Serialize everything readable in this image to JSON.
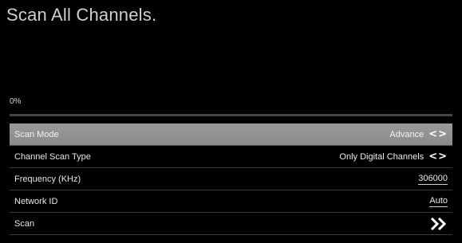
{
  "title": "Scan All Channels.",
  "progress": {
    "text": "0%",
    "value": 0
  },
  "menu": {
    "rows": [
      {
        "label": "Scan Mode",
        "value": "Advance",
        "arrows": "<>"
      },
      {
        "label": "Channel Scan Type",
        "value": "Only Digital Channels",
        "arrows": "<>"
      },
      {
        "label": "Frequency (KHz)",
        "value": "306000"
      },
      {
        "label": "Network ID",
        "value": "Auto"
      },
      {
        "label": "Scan",
        "icon": "double-chevron-right-icon"
      }
    ]
  }
}
